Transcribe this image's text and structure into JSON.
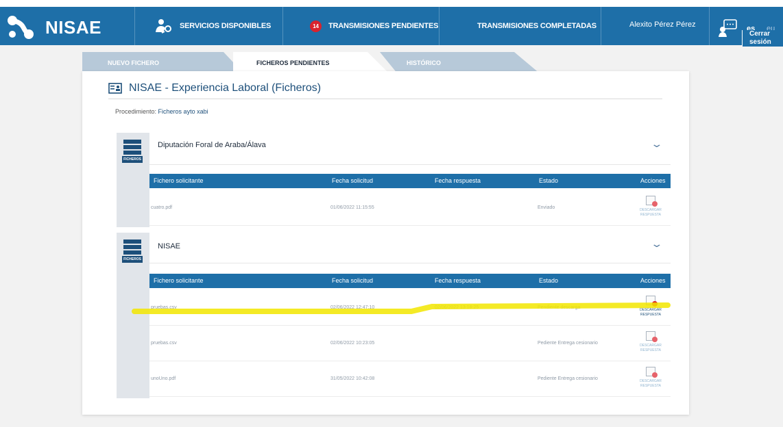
{
  "header": {
    "brand": "NISAE",
    "nav": [
      {
        "label": "SERVICIOS DISPONIBLES",
        "icon": "user-gear-icon"
      },
      {
        "label": "TRANSMISIONES PENDIENTES",
        "badge": "14"
      },
      {
        "label": "TRANSMISIONES COMPLETADAS"
      }
    ],
    "user": "Alexito Pérez Pérez",
    "lang_es": "es",
    "lang_eu": "eu",
    "logout": "Cerrar sesión"
  },
  "tabs": [
    {
      "label": "NUEVO FICHERO",
      "active": false
    },
    {
      "label": "FICHEROS PENDIENTES",
      "active": true
    },
    {
      "label": "HISTÓRICO",
      "active": false
    }
  ],
  "panel": {
    "title": "NISAE - Experiencia Laboral (Ficheros)",
    "procedure_label": "Procedimiento:",
    "procedure_value": "Ficheros ayto xabi"
  },
  "table_headers": [
    "Fichero solicitante",
    "Fecha solicitud",
    "Fecha respuesta",
    "Estado",
    "Acciones"
  ],
  "group_icon_label": "FICHEROS",
  "action_label": "DESCARGAR RESPUESTA",
  "groups": [
    {
      "name": "Diputación Foral de Araba/Álava",
      "rows": [
        {
          "file": "cuatro.pdf",
          "requested": "01/06/2022 11:15:55",
          "responded": "",
          "status": "Enviado"
        }
      ]
    },
    {
      "name": "NISAE",
      "rows": [
        {
          "file": "pruebas.csv",
          "requested": "02/06/2022 12:47:10",
          "responded": "02/06/2022 13:18:25",
          "status": "Pendiente descarga"
        },
        {
          "file": "pruebas.csv",
          "requested": "02/06/2022 10:23:05",
          "responded": "",
          "status": "Pediente Entrega cesionario"
        },
        {
          "file": "unoUno.pdf",
          "requested": "31/05/2022 10:42:08",
          "responded": "",
          "status": "Pediente Entrega cesionario"
        }
      ]
    }
  ],
  "colors": {
    "brand": "#1e6fa8",
    "badge": "#d9232d",
    "highlight": "#f2e600"
  }
}
